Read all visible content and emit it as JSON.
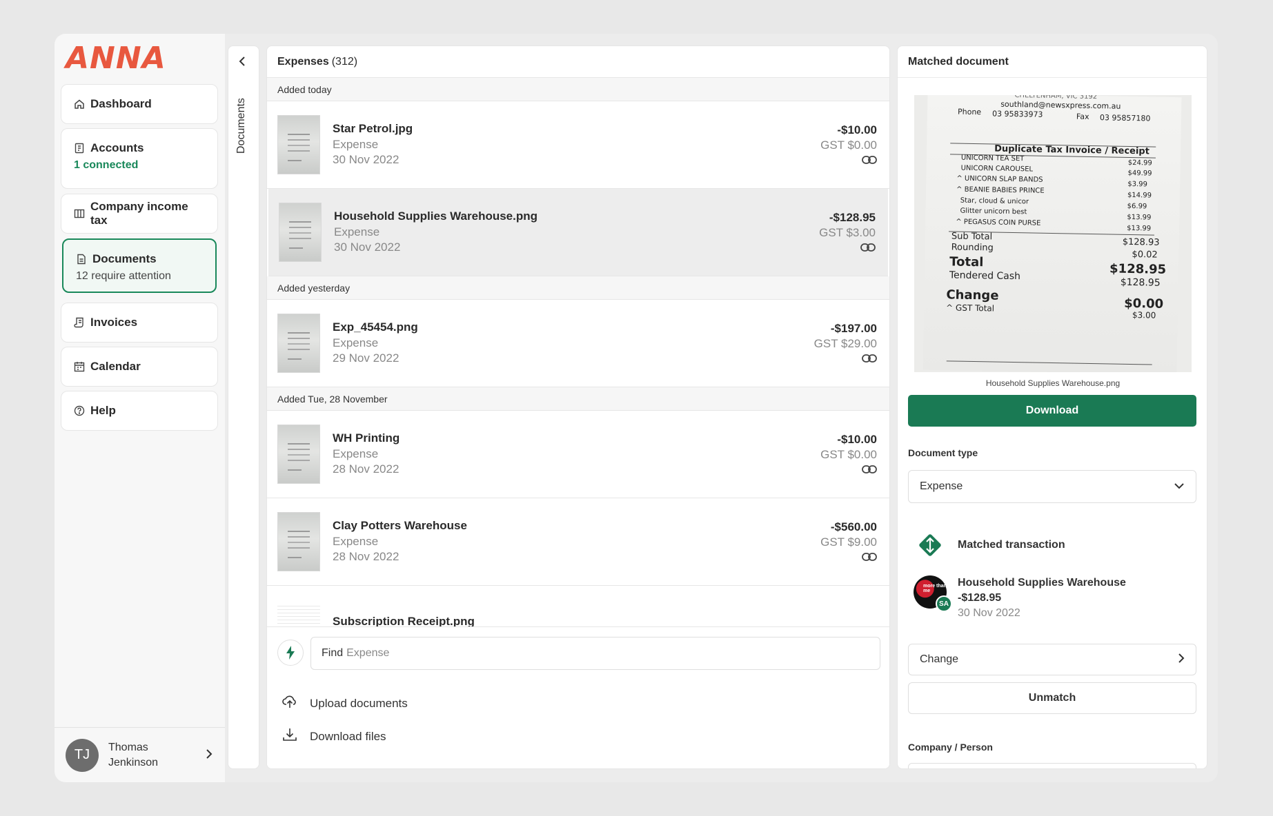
{
  "brand": {
    "logo": "ANNA",
    "accent": "#e8583f",
    "primary": "#1a7a54"
  },
  "sidebar": {
    "items": [
      {
        "label": "Dashboard",
        "icon": "home-icon"
      },
      {
        "label": "Accounts",
        "sub": "1 connected",
        "icon": "accounts-icon"
      },
      {
        "label": "Company income tax",
        "icon": "columns-icon"
      },
      {
        "label": "Documents",
        "sub": "12 require attention",
        "icon": "document-icon"
      },
      {
        "label": "Invoices",
        "icon": "invoice-icon"
      },
      {
        "label": "Calendar",
        "icon": "calendar-icon"
      },
      {
        "label": "Help",
        "icon": "help-icon"
      }
    ],
    "user": {
      "initials": "TJ",
      "first": "Thomas",
      "last": "Jenkinson"
    }
  },
  "rail": {
    "label": "Documents"
  },
  "expenses": {
    "title": "Expenses",
    "count": "(312)",
    "groups": [
      {
        "label": "Added today",
        "rows": [
          {
            "name": "Star Petrol.jpg",
            "type": "Expense",
            "date": "30 Nov 2022",
            "amount": "-$10.00",
            "gst": "GST $0.00"
          },
          {
            "name": "Household Supplies Warehouse.png",
            "type": "Expense",
            "date": "30 Nov 2022",
            "amount": "-$128.95",
            "gst": "GST $3.00"
          }
        ]
      },
      {
        "label": "Added yesterday",
        "rows": [
          {
            "name": "Exp_45454.png",
            "type": "Expense",
            "date": "29 Nov 2022",
            "amount": "-$197.00",
            "gst": "GST $29.00"
          }
        ]
      },
      {
        "label": "Added Tue, 28 November",
        "rows": [
          {
            "name": "WH Printing",
            "type": "Expense",
            "date": "28 Nov 2022",
            "amount": "-$10.00",
            "gst": "GST $0.00"
          },
          {
            "name": "Clay Potters Warehouse",
            "type": "Expense",
            "date": "28 Nov 2022",
            "amount": "-$560.00",
            "gst": "GST $9.00"
          },
          {
            "name": "Subscription Receipt.png"
          }
        ]
      }
    ],
    "find": {
      "prefix": "Find",
      "placeholder": "Expense"
    },
    "upload_label": "Upload documents",
    "download_label": "Download files"
  },
  "matched": {
    "title": "Matched document",
    "filename": "Household Supplies Warehouse.png",
    "download_label": "Download",
    "doc_type_label": "Document type",
    "doc_type_value": "Expense",
    "match_title": "Matched transaction",
    "tx": {
      "name": "Household Supplies Warehouse",
      "amount": "-$128.95",
      "date": "30 Nov 2022",
      "badge": "SA",
      "avatar_text": "more than me"
    },
    "change_label": "Change",
    "unmatch_label": "Unmatch",
    "company_label": "Company / Person",
    "receipt": {
      "header_cut": "CHELTENHAM, VIC 3192",
      "email": "southland@newsxpress.com.au",
      "phone_label": "Phone",
      "phone": "03 95833973",
      "fax_label": "Fax",
      "fax": "03 95857180",
      "title": "Duplicate Tax Invoice / Receipt",
      "items": [
        {
          "name": "UNICORN TEA SET",
          "price": "$24.99"
        },
        {
          "name": "UNICORN CAROUSEL",
          "price": "$49.99"
        },
        {
          "name": "^ UNICORN SLAP BANDS",
          "price": "$3.99"
        },
        {
          "name": "^ BEANIE BABIES PRINCE",
          "price": "$14.99"
        },
        {
          "name": "Star, cloud & unicor",
          "price": "$6.99"
        },
        {
          "name": "Glitter unicorn best",
          "price": "$13.99"
        },
        {
          "name": "^ PEGASUS COIN PURSE",
          "price": "$13.99"
        }
      ],
      "sub_total_label": "Sub Total",
      "sub_total": "$128.93",
      "rounding_label": "Rounding",
      "rounding": "$0.02",
      "total_label": "Total",
      "total": "$128.95",
      "tendered_label": "Tendered Cash",
      "tendered": "$128.95",
      "change_label": "Change",
      "change": "$0.00",
      "gst_label": "^ GST Total",
      "gst": "$3.00"
    }
  }
}
